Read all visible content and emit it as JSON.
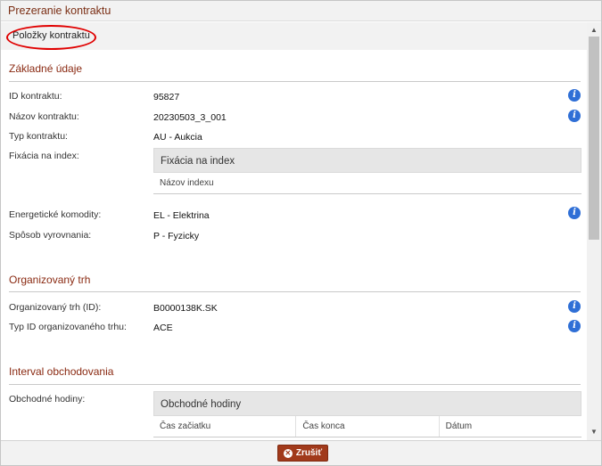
{
  "dialog": {
    "title": "Prezeranie kontraktu"
  },
  "tabs": [
    {
      "label": "Položky kontraktu"
    }
  ],
  "sections": {
    "basic": {
      "title": "Základné údaje",
      "fields": [
        {
          "label": "ID kontraktu:",
          "value": "95827"
        },
        {
          "label": "Názov kontraktu:",
          "value": "20230503_3_001"
        },
        {
          "label": "Typ kontraktu:",
          "value": "AU - Aukcia"
        },
        {
          "label": "Fixácia na index:",
          "value": ""
        },
        {
          "label": "Energetické komodity:",
          "value": "EL - Elektrina"
        },
        {
          "label": "Spôsob vyrovnania:",
          "value": "P - Fyzicky"
        }
      ],
      "index_table": {
        "title": "Fixácia na index",
        "columns": [
          "Názov indexu"
        ]
      }
    },
    "market": {
      "title": "Organizovaný trh",
      "fields": [
        {
          "label": "Organizovaný trh (ID):",
          "value": "B0000138K.SK"
        },
        {
          "label": "Typ ID organizovaného trhu:",
          "value": "ACE"
        }
      ]
    },
    "trading": {
      "title": "Interval obchodovania",
      "fields": [
        {
          "label": "Obchodné hodiny:",
          "value": ""
        }
      ],
      "hours_table": {
        "title": "Obchodné hodiny",
        "columns": [
          "Čas začiatku",
          "Čas konca",
          "Dátum"
        ]
      }
    }
  },
  "footer": {
    "cancel_label": "Zrušiť"
  },
  "icons": {
    "info": "info-icon",
    "close": "close-icon",
    "cancel": "x-circle-icon"
  },
  "colors": {
    "accent": "#8a2a12",
    "button": "#a13a1b",
    "info": "#2f6fd6",
    "highlight": "#e00000"
  }
}
